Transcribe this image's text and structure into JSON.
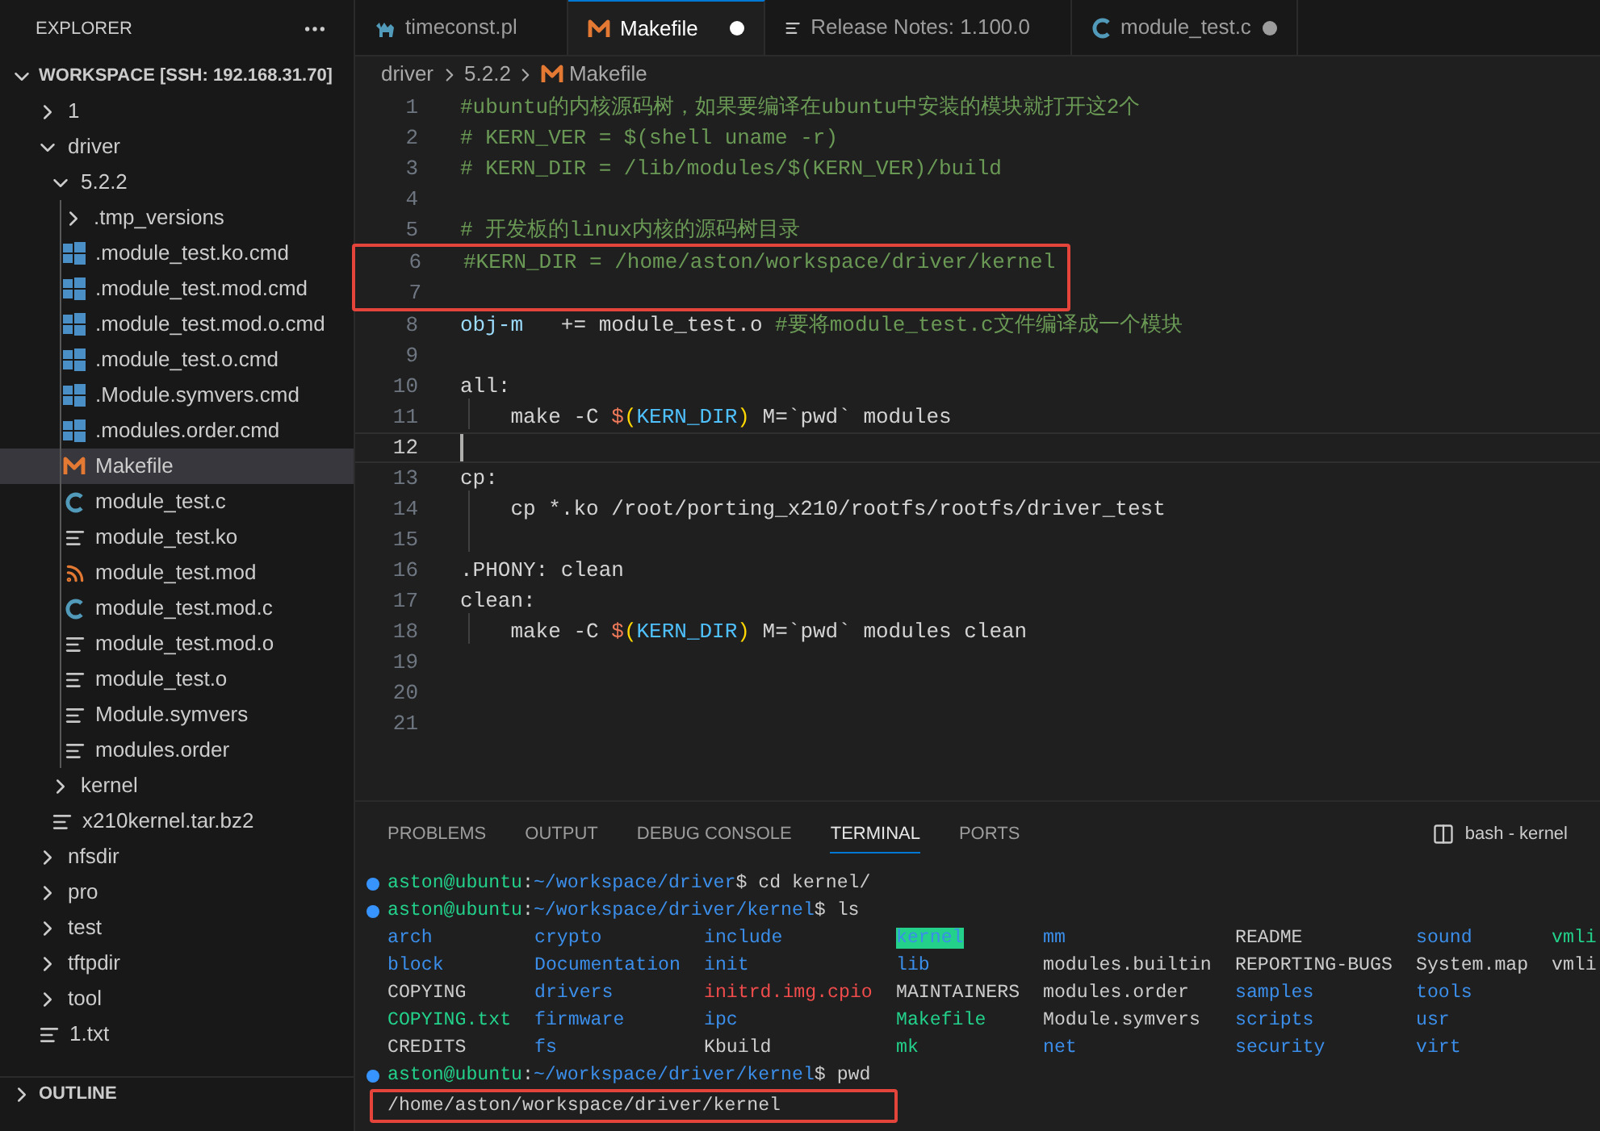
{
  "sidebar": {
    "title": "EXPLORER",
    "workspace": {
      "label": "WORKSPACE [SSH: 192.168.31.70]",
      "expanded": true
    },
    "tree": [
      {
        "kind": "folder",
        "name": "1",
        "expanded": false,
        "selected": false
      },
      {
        "kind": "folder",
        "name": "driver",
        "expanded": true,
        "selected": false,
        "children": [
          {
            "kind": "folder",
            "name": "5.2.2",
            "expanded": true,
            "selected": false,
            "children": [
              {
                "kind": "folder",
                "name": ".tmp_versions",
                "expanded": false,
                "selected": false
              },
              {
                "kind": "cmd",
                "name": ".module_test.ko.cmd",
                "selected": false
              },
              {
                "kind": "cmd",
                "name": ".module_test.mod.cmd",
                "selected": false
              },
              {
                "kind": "cmd",
                "name": ".module_test.mod.o.cmd",
                "selected": false
              },
              {
                "kind": "cmd",
                "name": ".module_test.o.cmd",
                "selected": false
              },
              {
                "kind": "cmd",
                "name": ".Module.symvers.cmd",
                "selected": false
              },
              {
                "kind": "cmd",
                "name": ".modules.order.cmd",
                "selected": false
              },
              {
                "kind": "makefile",
                "name": "Makefile",
                "selected": true
              },
              {
                "kind": "c",
                "name": "module_test.c",
                "selected": false
              },
              {
                "kind": "text",
                "name": "module_test.ko",
                "selected": false
              },
              {
                "kind": "feed",
                "name": "module_test.mod",
                "selected": false
              },
              {
                "kind": "c",
                "name": "module_test.mod.c",
                "selected": false
              },
              {
                "kind": "text",
                "name": "module_test.mod.o",
                "selected": false
              },
              {
                "kind": "text",
                "name": "module_test.o",
                "selected": false
              },
              {
                "kind": "text",
                "name": "Module.symvers",
                "selected": false
              },
              {
                "kind": "text",
                "name": "modules.order",
                "selected": false
              }
            ]
          },
          {
            "kind": "folder",
            "name": "kernel",
            "expanded": false,
            "selected": false
          },
          {
            "kind": "text",
            "name": "x210kernel.tar.bz2",
            "selected": false
          }
        ]
      },
      {
        "kind": "folder",
        "name": "nfsdir",
        "expanded": false,
        "selected": false
      },
      {
        "kind": "folder",
        "name": "pro",
        "expanded": false,
        "selected": false
      },
      {
        "kind": "folder",
        "name": "test",
        "expanded": false,
        "selected": false
      },
      {
        "kind": "folder",
        "name": "tftpdir",
        "expanded": false,
        "selected": false
      },
      {
        "kind": "folder",
        "name": "tool",
        "expanded": false,
        "selected": false
      },
      {
        "kind": "text",
        "name": "1.txt",
        "selected": false
      }
    ],
    "sections": [
      {
        "label": "OUTLINE",
        "expanded": false
      }
    ]
  },
  "tabs": [
    {
      "label": "timeconst.pl",
      "kind": "perl",
      "selected": false,
      "modified": false
    },
    {
      "label": "Makefile",
      "kind": "makefile",
      "selected": true,
      "modified": true
    },
    {
      "label": "Release Notes: 1.100.0",
      "kind": "text",
      "selected": false,
      "modified": false
    },
    {
      "label": "module_test.c",
      "kind": "c",
      "selected": false,
      "modified": true
    }
  ],
  "breadcrumbs": [
    {
      "label": "driver",
      "kind": "plain"
    },
    {
      "label": "5.2.2",
      "kind": "plain"
    },
    {
      "label": "Makefile",
      "kind": "makefile"
    }
  ],
  "code": [
    {
      "number": "1",
      "tokens": [
        {
          "kind": "comment",
          "text": "#ubuntu的内核源码树，如果要编译在ubuntu中安装的模块就打开这2个"
        }
      ],
      "current": false,
      "boxed": false
    },
    {
      "number": "2",
      "tokens": [
        {
          "kind": "comment",
          "text": "# KERN_VER = $(shell uname -r)"
        }
      ],
      "current": false,
      "boxed": false
    },
    {
      "number": "3",
      "tokens": [
        {
          "kind": "comment",
          "text": "# KERN_DIR = /lib/modules/$(KERN_VER)/build"
        }
      ],
      "current": false,
      "boxed": false
    },
    {
      "number": "4",
      "current": false,
      "boxed": false
    },
    {
      "number": "5",
      "tokens": [
        {
          "kind": "comment",
          "text": "# 开发板的linux内核的源码树目录"
        }
      ],
      "current": false,
      "boxed": false
    },
    {
      "number": "6",
      "tokens": [
        {
          "kind": "comment",
          "text": "#KERN_DIR = /home/aston/workspace/driver/kernel"
        }
      ],
      "current": false,
      "boxed": true
    },
    {
      "number": "7",
      "current": false,
      "boxed": true
    },
    {
      "number": "8",
      "tokens": [
        {
          "kind": "variable",
          "text": "obj-m"
        },
        {
          "kind": "plain",
          "text": "   += module_test.o "
        },
        {
          "kind": "comment",
          "text": "#要将module_test.c文件编译成一个模块"
        }
      ],
      "current": false,
      "boxed": false
    },
    {
      "number": "9",
      "current": false,
      "boxed": false
    },
    {
      "number": "10",
      "tokens": [
        {
          "kind": "plain",
          "text": "all:"
        }
      ],
      "current": false,
      "boxed": false
    },
    {
      "number": "11",
      "tokens": [
        {
          "kind": "plain",
          "text": "    make -C "
        },
        {
          "kind": "dollar",
          "text": "$"
        },
        {
          "kind": "paren",
          "text": "("
        },
        {
          "kind": "macro",
          "text": "KERN_DIR"
        },
        {
          "kind": "paren",
          "text": ")"
        },
        {
          "kind": "plain",
          "text": " M=`pwd` modules"
        }
      ],
      "current": false,
      "boxed": false
    },
    {
      "number": "12",
      "current": true,
      "boxed": false
    },
    {
      "number": "13",
      "tokens": [
        {
          "kind": "plain",
          "text": "cp:"
        }
      ],
      "current": false,
      "boxed": false
    },
    {
      "number": "14",
      "tokens": [
        {
          "kind": "plain",
          "text": "    cp *.ko /root/porting_x210/rootfs/rootfs/driver_test"
        }
      ],
      "current": false,
      "boxed": false
    },
    {
      "number": "15",
      "current": false,
      "boxed": false
    },
    {
      "number": "16",
      "tokens": [
        {
          "kind": "plain",
          "text": ".PHONY: clean"
        }
      ],
      "current": false,
      "boxed": false
    },
    {
      "number": "17",
      "tokens": [
        {
          "kind": "plain",
          "text": "clean:"
        }
      ],
      "current": false,
      "boxed": false
    },
    {
      "number": "18",
      "tokens": [
        {
          "kind": "plain",
          "text": "    make -C "
        },
        {
          "kind": "dollar",
          "text": "$"
        },
        {
          "kind": "paren",
          "text": "("
        },
        {
          "kind": "macro",
          "text": "KERN_DIR"
        },
        {
          "kind": "paren",
          "text": ")"
        },
        {
          "kind": "plain",
          "text": " M=`pwd` modules clean"
        }
      ],
      "current": false,
      "boxed": false
    },
    {
      "number": "19",
      "current": false,
      "boxed": false
    },
    {
      "number": "20",
      "current": false,
      "boxed": false
    },
    {
      "number": "21",
      "current": false,
      "boxed": false
    }
  ],
  "panel": {
    "tabs": [
      {
        "label": "PROBLEMS",
        "selected": false
      },
      {
        "label": "OUTPUT",
        "selected": false
      },
      {
        "label": "DEBUG CONSOLE",
        "selected": false
      },
      {
        "label": "TERMINAL",
        "selected": true
      },
      {
        "label": "PORTS",
        "selected": false
      }
    ],
    "terminal_name": "bash - kernel",
    "lines": [
      {
        "kind": "prompt",
        "user": "aston@ubuntu",
        "sep": ":",
        "path": "~/workspace/driver",
        "command": "$ cd kernel/",
        "boxed": false
      },
      {
        "kind": "prompt",
        "user": "aston@ubuntu",
        "sep": ":",
        "path": "~/workspace/driver/kernel",
        "command": "$ ls",
        "boxed": false
      },
      {
        "kind": "ls",
        "boxed": false,
        "cells": [
          {
            "text": "arch",
            "kind": "dir"
          },
          {
            "text": "crypto",
            "kind": "dir"
          },
          {
            "text": "include",
            "kind": "dir"
          },
          {
            "text": "kernel",
            "kind": "sticky"
          },
          {
            "text": "mm",
            "kind": "dir"
          },
          {
            "text": "README",
            "kind": "file"
          },
          {
            "text": "sound",
            "kind": "dir"
          },
          {
            "text": "vmli",
            "kind": "exec"
          }
        ]
      },
      {
        "kind": "ls",
        "boxed": false,
        "cells": [
          {
            "text": "block",
            "kind": "dir"
          },
          {
            "text": "Documentation",
            "kind": "dir"
          },
          {
            "text": "init",
            "kind": "dir"
          },
          {
            "text": "lib",
            "kind": "dir"
          },
          {
            "text": "modules.builtin",
            "kind": "file"
          },
          {
            "text": "REPORTING-BUGS",
            "kind": "file"
          },
          {
            "text": "System.map",
            "kind": "file"
          },
          {
            "text": "vmli",
            "kind": "file"
          }
        ]
      },
      {
        "kind": "ls",
        "boxed": false,
        "cells": [
          {
            "text": "COPYING",
            "kind": "file"
          },
          {
            "text": "drivers",
            "kind": "dir"
          },
          {
            "text": "initrd.img.cpio",
            "kind": "archive"
          },
          {
            "text": "MAINTAINERS",
            "kind": "file"
          },
          {
            "text": "modules.order",
            "kind": "file"
          },
          {
            "text": "samples",
            "kind": "dir"
          },
          {
            "text": "tools",
            "kind": "dir"
          }
        ]
      },
      {
        "kind": "ls",
        "boxed": false,
        "cells": [
          {
            "text": "COPYING.txt",
            "kind": "exec"
          },
          {
            "text": "firmware",
            "kind": "dir"
          },
          {
            "text": "ipc",
            "kind": "dir"
          },
          {
            "text": "Makefile",
            "kind": "exec"
          },
          {
            "text": "Module.symvers",
            "kind": "file"
          },
          {
            "text": "scripts",
            "kind": "dir"
          },
          {
            "text": "usr",
            "kind": "dir"
          }
        ]
      },
      {
        "kind": "ls",
        "boxed": false,
        "cells": [
          {
            "text": "CREDITS",
            "kind": "file"
          },
          {
            "text": "fs",
            "kind": "dir"
          },
          {
            "text": "Kbuild",
            "kind": "file"
          },
          {
            "text": "mk",
            "kind": "exec"
          },
          {
            "text": "net",
            "kind": "dir"
          },
          {
            "text": "security",
            "kind": "dir"
          },
          {
            "text": "virt",
            "kind": "dir"
          }
        ]
      },
      {
        "kind": "prompt",
        "user": "aston@ubuntu",
        "sep": ":",
        "path": "~/workspace/driver/kernel",
        "command": "$ pwd",
        "boxed": false
      },
      {
        "kind": "output",
        "text": "/home/aston/workspace/driver/kernel",
        "boxed": true
      }
    ]
  }
}
